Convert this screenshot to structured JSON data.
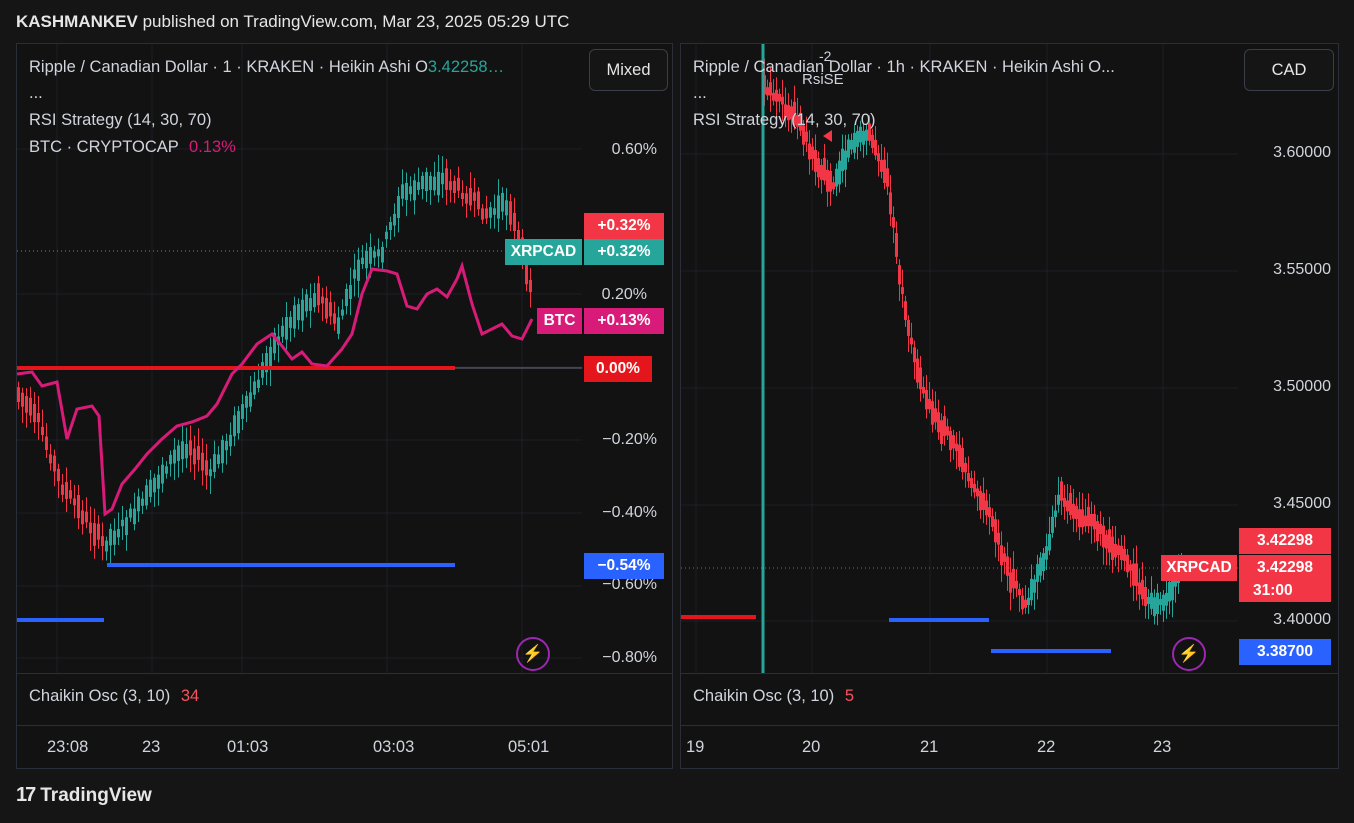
{
  "header": {
    "author": "KASHMANKEV",
    "text": "published on TradingView.com, Mar 23, 2025 05:29 UTC"
  },
  "left": {
    "title": "Ripple / Canadian Dollar · 1 · KRAKEN · Heikin Ashi  O",
    "open_value": "3.42258…",
    "ellipsis": "...",
    "indicator": "RSI Strategy (14, 30, 70)",
    "compare_label": "BTC · CRYPTOCAP",
    "compare_value": "0.13%",
    "scale_button": "Mixed",
    "y_labels": [
      "0.60%",
      "0.20%",
      "−0.20%",
      "−0.40%",
      "−0.60%",
      "−0.80%"
    ],
    "tags": {
      "top": "+0.32%",
      "sym": "XRPCAD",
      "sym_val": "+0.32%",
      "btc": "BTC",
      "btc_val": "+0.13%",
      "zero": "0.00%",
      "low": "−0.54%"
    },
    "x_labels": [
      "23:08",
      "23",
      "01:03",
      "03:03",
      "05:01"
    ],
    "oscillator": "Chaikin Osc (3, 10)",
    "osc_value": "34"
  },
  "right": {
    "title": "Ripple / Canadian Dollar · 1h · KRAKEN · Heikin Ashi  O...",
    "ellipsis": "...",
    "indicator": "RSI Strategy (14, 30, 70)",
    "signal_label": "RsiSE",
    "signal_num": "-2",
    "currency_button": "CAD",
    "y_labels": [
      "3.60000",
      "3.55000",
      "3.50000",
      "3.45000",
      "3.40000"
    ],
    "tags": {
      "price": "3.42298",
      "sym": "XRPCAD",
      "sym_price": "3.42298",
      "countdown": "31:00",
      "low": "3.38700"
    },
    "x_labels": [
      "19",
      "20",
      "21",
      "22",
      "23"
    ],
    "oscillator": "Chaikin Osc (3, 10)",
    "osc_value": "5"
  },
  "footer": {
    "brand": "TradingView",
    "logo": "17"
  },
  "colors": {
    "up": "#26a69a",
    "down": "#f23645",
    "btc": "#d81b78",
    "blue": "#2962ff",
    "red_line": "#e5161b",
    "bg": "#121212"
  }
}
